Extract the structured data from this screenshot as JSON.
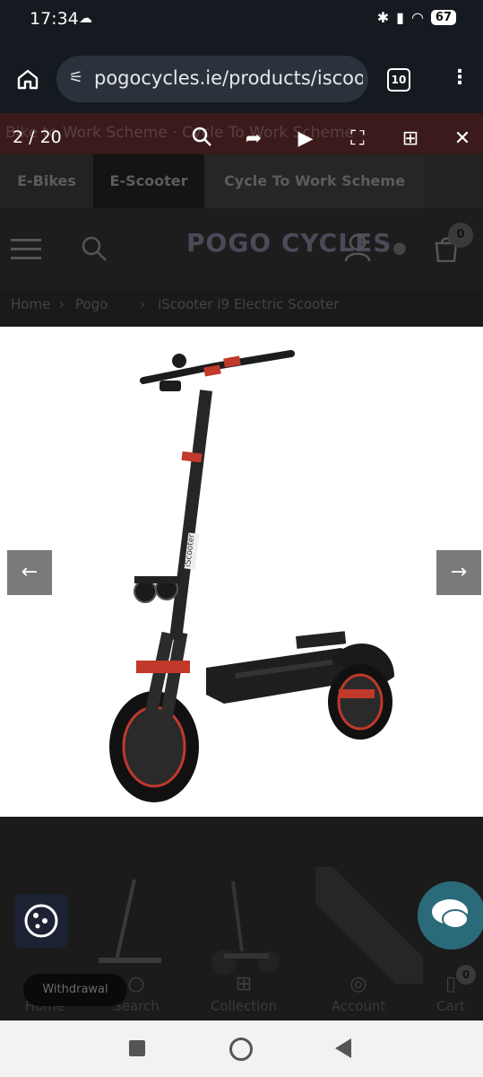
{
  "status_bar": {
    "time": "17:34",
    "battery": "67"
  },
  "browser": {
    "url": "pogocycles.ie/products/iscooter",
    "tab_count": "10"
  },
  "viewer": {
    "counter": "2 / 20"
  },
  "page": {
    "announcement": "Bike to Work Scheme  ·  Cycle To Work Scheme",
    "nav_tabs": [
      "E-Bikes",
      "E-Scooter",
      "Cycle To Work Scheme"
    ],
    "logo": "POGO CYCLES",
    "cart_count": "0",
    "breadcrumb": [
      "Home",
      "Pogo",
      "iScooter i9 Electric Scooter"
    ],
    "bottom_nav": [
      {
        "label": "Home",
        "icon": "home-icon"
      },
      {
        "label": "Search",
        "icon": "search-icon"
      },
      {
        "label": "Collection",
        "icon": "grid-icon"
      },
      {
        "label": "Account",
        "icon": "user-icon"
      },
      {
        "label": "Cart",
        "icon": "cart-icon"
      }
    ],
    "bottom_cart_count": "0",
    "withdrawal": "Withdrawal"
  },
  "product_image_label": "iScooter"
}
